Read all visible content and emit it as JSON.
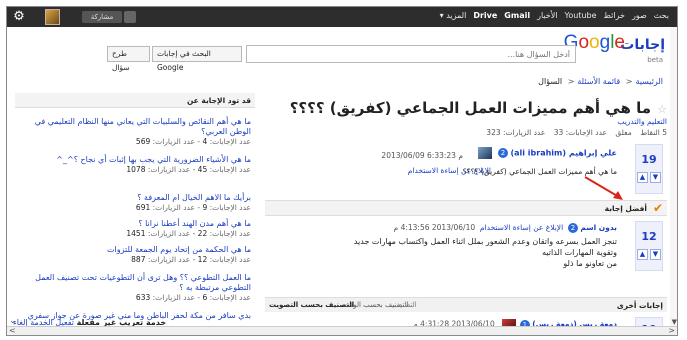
{
  "topbar": {
    "nav": [
      "بحث",
      "صور",
      "خرائط",
      "Youtube",
      "الأخبار",
      "Gmail",
      "Drive",
      "المزيد ▾"
    ],
    "share_label": "مشاركة",
    "gear_icon": "gear-icon"
  },
  "header": {
    "logo_ar": "إجابات",
    "logo_google": "Google",
    "logo_beta": "beta",
    "search_placeholder": "أدخل السؤال هنا...",
    "search_button": "البحث في إجابات Google",
    "ask_button": "طرح سؤال"
  },
  "breadcrumb": [
    "الرئيسية",
    "قائمة الأسئلة",
    "السؤال"
  ],
  "question": {
    "title": "ما هي أهم مميزات العمل الجماعي (كفريق) ؟؟؟؟",
    "category": "التعليم والتدريب",
    "points": "5 النقاط",
    "status": "معلق",
    "answers": "عدد الإجابات: 33",
    "visits": "عدد الزيارات: 323",
    "votes": "19",
    "user_name": "علي إبراهيم (ali ibrahim)",
    "user_badge": "2",
    "date": "2013/06/09 6:33:23 م",
    "report": "الإبلاغ عن إساءة الاستخدام",
    "body": "ما هي أهم مميزات العمل الجماعي (كفريق) ؟؟؟؟"
  },
  "best_answer": {
    "label": "أفضل إجابة",
    "votes": "12",
    "user_name": "بدون اسم",
    "user_badge": "2",
    "date": "2013/06/10 4:13:56 م",
    "report": "الإبلاغ عن إساءة الاستخدام",
    "lines": [
      "تنجز العمل بسرعه واتقان وعدم الشعور بملل اثناء العمل واكتساب مهارات جديد",
      "وتقوية المهارات الذاتيه",
      "من تعاونو ما ذلو"
    ]
  },
  "other_answers": {
    "label": "إجابات أخرى",
    "sort_by_votes": "التصنيف بحسب التصويت",
    "sort_by_time": "التصنيف بحسب الوقت",
    "sort_note": "التصنيف",
    "votes": "10",
    "user_name": "دمعة ريس (دمعة ريس)",
    "user_badge": "1",
    "date": "2013/06/10 4:31:28 م"
  },
  "sidebar": {
    "title": "قد تود الإجابة عن",
    "items": [
      {
        "q": "ما هي أهم النقائص والسلبيات التي يعاني منها النظام التعليمي في الوطن العربي؟",
        "ans": "4",
        "visits": "569"
      },
      {
        "q": "ما هي الأشياء الضرورية التي يجب بها إثبات أي نجاح ؟^_^",
        "ans": "45",
        "visits": "1078"
      },
      {
        "q": "برأيك ما الاهم الخيال ام المعرفة ؟",
        "ans": "9",
        "visits": "691"
      },
      {
        "q": "ما هي أهم مدن الهند أعطنا نرانا ؟",
        "ans": "22",
        "visits": "1451"
      },
      {
        "q": "ما هي الحكمة من إتحاد يوم الجمعة للتزوات",
        "ans": "12",
        "visits": "887"
      },
      {
        "q": "ما العمل التطوعي ؟؟ وهل ترى أن التطوعيات تحت تصنيف العمل التطوعي مرتبطة به ؟",
        "ans": "6",
        "visits": "633"
      },
      {
        "q": "بدي سافر من مكة لحفر الباطن وما مني غير صورة عن جواز سفري",
        "ans": "",
        "visits": ""
      }
    ],
    "ans_label": "عدد الإجابات:",
    "visits_label": "عدد الزيارات:"
  },
  "footer": {
    "service_text": "خدمة تعريب غير مفعلة",
    "enable_link": "تفعيل الخدمة",
    "cancel_link": "إلغاء"
  }
}
